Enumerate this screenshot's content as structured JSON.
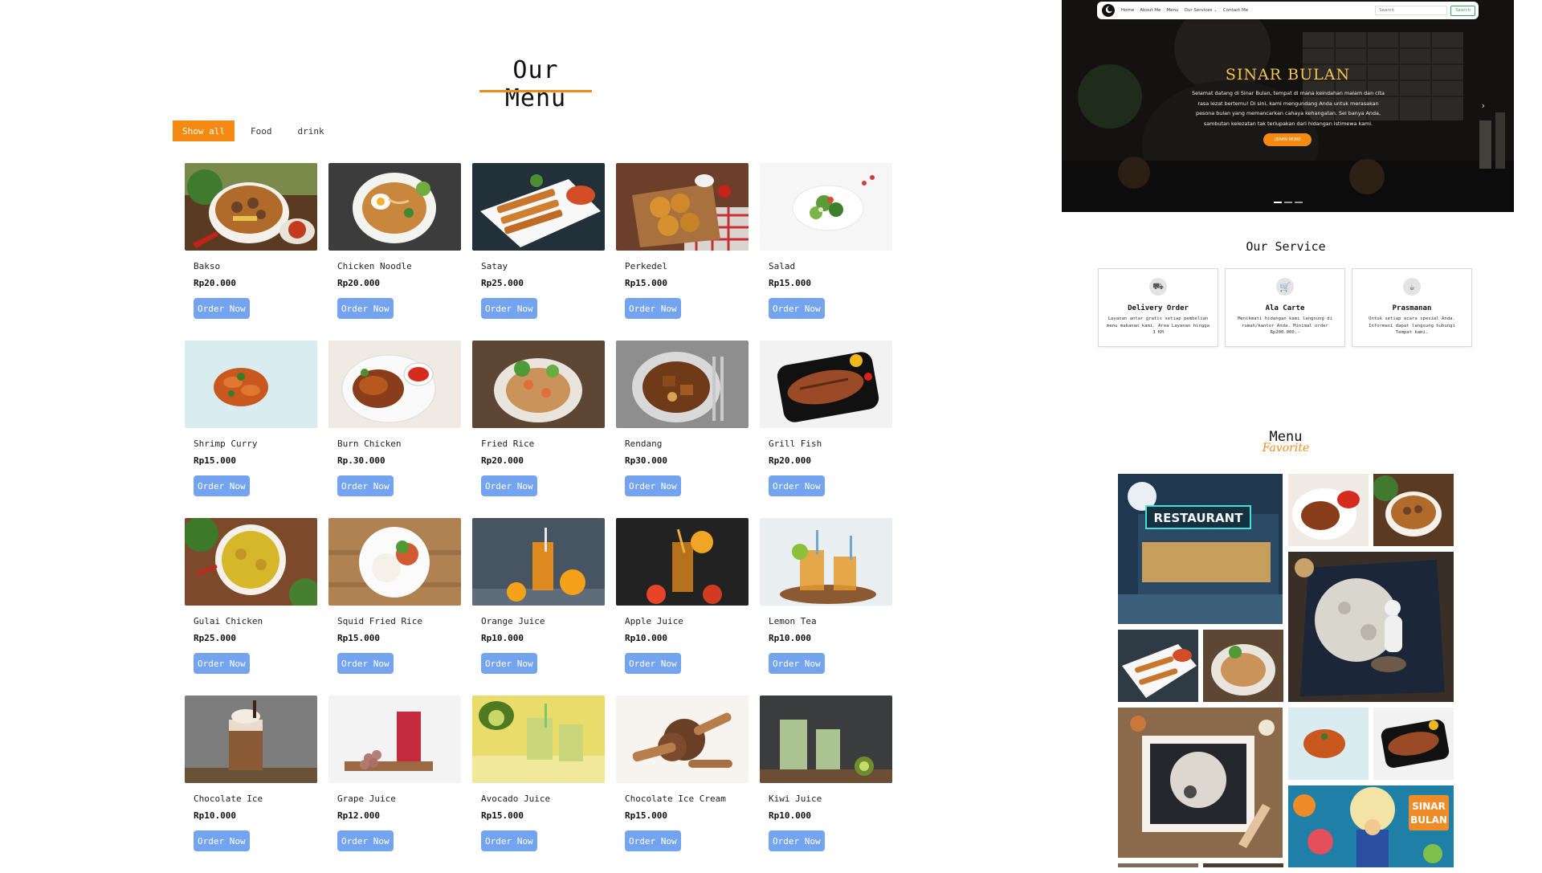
{
  "menu_section": {
    "title": "Our Menu",
    "filters": [
      "Show all",
      "Food",
      "drink"
    ],
    "accent": "#f48a12",
    "button_color": "#74a3ef",
    "items": [
      {
        "name": "Bakso",
        "price": "Rp20.000",
        "button": "Order Now"
      },
      {
        "name": "Chicken Noodle",
        "price": "Rp20.000",
        "button": "Order Now"
      },
      {
        "name": "Satay",
        "price": "Rp25.000",
        "button": "Order Now"
      },
      {
        "name": "Perkedel",
        "price": "Rp15.000",
        "button": "Order Now"
      },
      {
        "name": "Salad",
        "price": "Rp15.000",
        "button": "Order Now"
      },
      {
        "name": "Shrimp Curry",
        "price": "Rp15.000",
        "button": "Order Now"
      },
      {
        "name": "Burn Chicken",
        "price": "Rp.30.000",
        "button": "Order Now"
      },
      {
        "name": "Fried Rice",
        "price": "Rp20.000",
        "button": "Order Now"
      },
      {
        "name": "Rendang",
        "price": "Rp30.000",
        "button": "Order Now"
      },
      {
        "name": "Grill Fish",
        "price": "Rp20.000",
        "button": "Order Now"
      },
      {
        "name": "Gulai Chicken",
        "price": "Rp25.000",
        "button": "Order Now"
      },
      {
        "name": "Squid Fried Rice",
        "price": "Rp15.000",
        "button": "Order Now"
      },
      {
        "name": "Orange Juice",
        "price": "Rp10.000",
        "button": "Order Now"
      },
      {
        "name": "Apple Juice",
        "price": "Rp10.000",
        "button": "Order Now"
      },
      {
        "name": "Lemon Tea",
        "price": "Rp10.000",
        "button": "Order Now"
      },
      {
        "name": "Chocolate Ice",
        "price": "Rp10.000",
        "button": "Order Now"
      },
      {
        "name": "Grape Juice",
        "price": "Rp12.000",
        "button": "Order Now"
      },
      {
        "name": "Avocado Juice",
        "price": "Rp15.000",
        "button": "Order Now"
      },
      {
        "name": "Chocolate Ice Cream",
        "price": "Rp15.000",
        "button": "Order Now"
      },
      {
        "name": "Kiwi Juice",
        "price": "Rp10.000",
        "button": "Order Now"
      }
    ]
  },
  "hero": {
    "nav_links": [
      "Home",
      "About Me",
      "Menu",
      "Our Services ⌄",
      "Contact Me"
    ],
    "search_placeholder": "Search",
    "search_button": "Search",
    "title": "SINAR BULAN",
    "text": "Selamat datang di Sinar Bulan, tempat di mana keindahan malam dan cita rasa lezat bertemu! Di sini, kami mengundang Anda untuk merasakan pesona bulan yang memancarkan cahaya kehangatan. Sei banya Anda, sambutan kelezatan tak terlupakan dari hidangan istimewa kami.",
    "cta": "LEARN MORE",
    "next_arrow": "›"
  },
  "services": {
    "title": "Our Service",
    "cards": [
      {
        "icon": "truck-icon",
        "glyph": "⛟",
        "name": "Delivery Order",
        "desc": "Layanan antar gratis setiap pembelian menu makanan kami. Area Layanan hingga 3 KM"
      },
      {
        "icon": "cart-icon",
        "glyph": "🛒",
        "name": "Ala Carte",
        "desc": "Menikmati hidangan kami langsung di rumah/kantor Anda. Minimal order Rp200.000,-"
      },
      {
        "icon": "cup-icon",
        "glyph": "☕",
        "name": "Prasmanan",
        "desc": "Untuk setiap acara spesial Anda. Informasi dapat langsung hubungi Tempat kami."
      }
    ]
  },
  "favorite": {
    "title": "Menu",
    "subtitle": "Favorite",
    "sign_text": "RESTAURANT",
    "badge_text": [
      "SINAR",
      "BULAN"
    ]
  }
}
